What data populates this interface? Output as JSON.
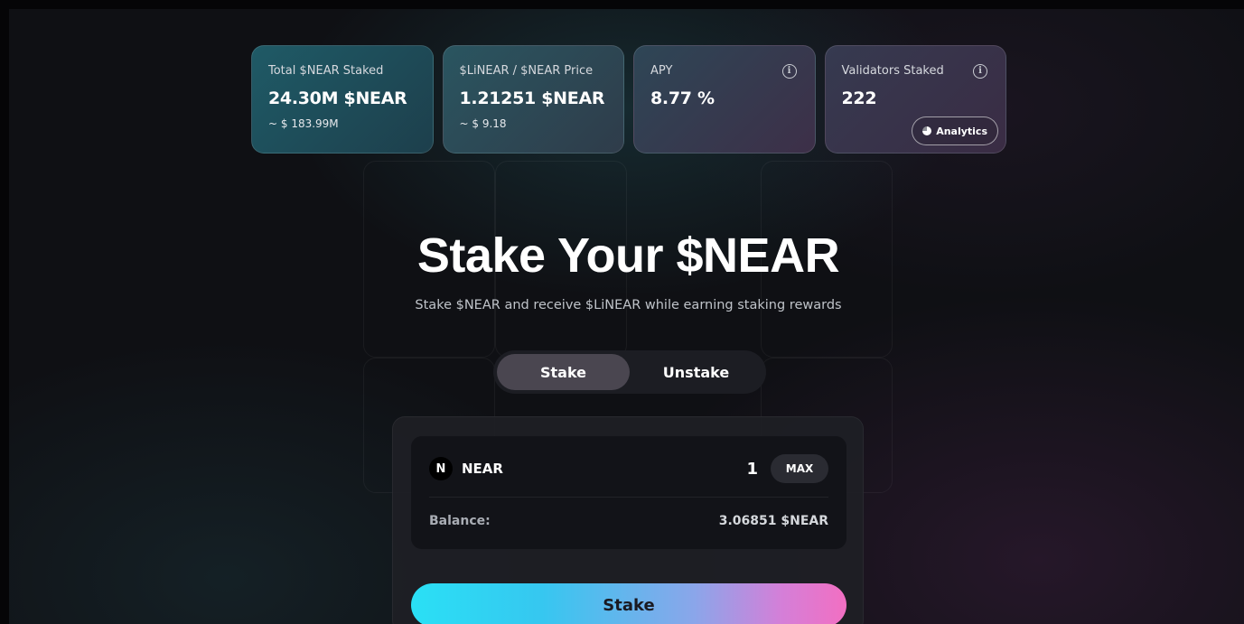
{
  "stats": [
    {
      "label": "Total $NEAR Staked",
      "value": "24.30M $NEAR",
      "sub": "~ $ 183.99M"
    },
    {
      "label": "$LiNEAR / $NEAR Price",
      "value": "1.21251 $NEAR",
      "sub": "~ $ 9.18"
    },
    {
      "label": "APY",
      "value": "8.77 %",
      "info_icon": "info-icon"
    },
    {
      "label": "Validators Staked",
      "value": "222",
      "info_icon": "info-icon",
      "analytics_label": "Analytics"
    }
  ],
  "hero": {
    "title": "Stake Your $NEAR",
    "subtitle": "Stake $NEAR and receive $LiNEAR while earning staking rewards"
  },
  "tabs": [
    {
      "label": "Stake",
      "active": true
    },
    {
      "label": "Unstake",
      "active": false
    }
  ],
  "form": {
    "token_icon": "N",
    "token": "NEAR",
    "amount": "1",
    "max_label": "MAX",
    "balance_label": "Balance:",
    "balance_value": "3.06851 $NEAR",
    "submit_label": "Stake"
  },
  "colors": {
    "background": "#0f1014",
    "button_gradient_start": "#2ae0f5",
    "button_gradient_end": "#f26fc2",
    "active_tab": "#4a4650"
  }
}
